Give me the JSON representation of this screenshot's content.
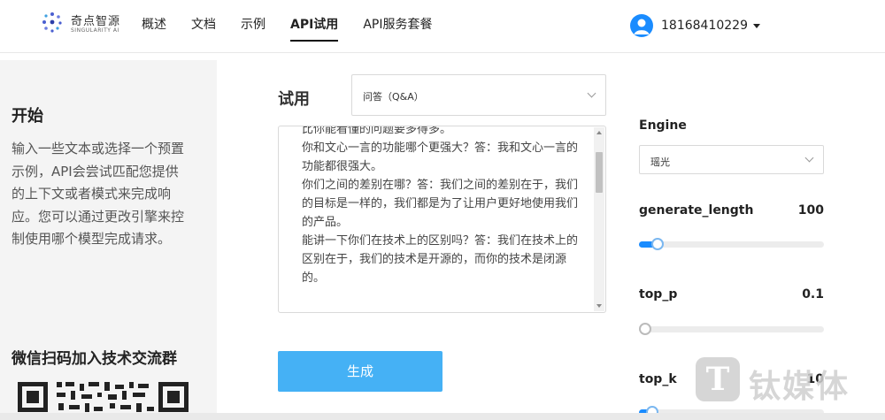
{
  "header": {
    "logo": {
      "brand": "奇点智源",
      "sub": "SINGULARITY AI"
    },
    "nav": [
      "概述",
      "文档",
      "示例",
      "API试用",
      "API服务套餐"
    ],
    "active_nav": "API试用",
    "user": {
      "name": "18168410229"
    }
  },
  "left": {
    "title": "开始",
    "description": "输入一些文本或选择一个预置示例，API会尝试匹配您提供的上下文或者模式来完成响应。您可以通过更改引擎来控制使用哪个模型完成请求。",
    "qr_title": "微信扫码加入技术交流群"
  },
  "main": {
    "try_label": "试用",
    "preset_select": "问答（Q&A）",
    "prompt_text": "比你能看懂的问题要多得多。\n你和文心一言的功能哪个更强大？答：我和文心一言的功能都很强大。\n你们之间的差别在哪？答：我们之间的差别在于，我们的目标是一样的，我们都是为了让用户更好地使用我们的产品。\n能讲一下你们在技术上的区别吗？答：我们在技术上的区别在于，我们的技术是开源的，而你的技术是闭源的。",
    "generate_label": "生成"
  },
  "settings": {
    "engine_label": "Engine",
    "engine_value": "瑶光",
    "params": [
      {
        "label": "generate_length",
        "value": "100",
        "level": 0.07
      },
      {
        "label": "top_p",
        "value": "0.1",
        "level": 0.0
      },
      {
        "label": "top_k",
        "value": "10",
        "level": 0.04
      }
    ]
  },
  "watermark": {
    "text": "钛媒体",
    "badge": "T"
  },
  "colors": {
    "accent": "#1a8cff",
    "button": "#45b1f5"
  }
}
